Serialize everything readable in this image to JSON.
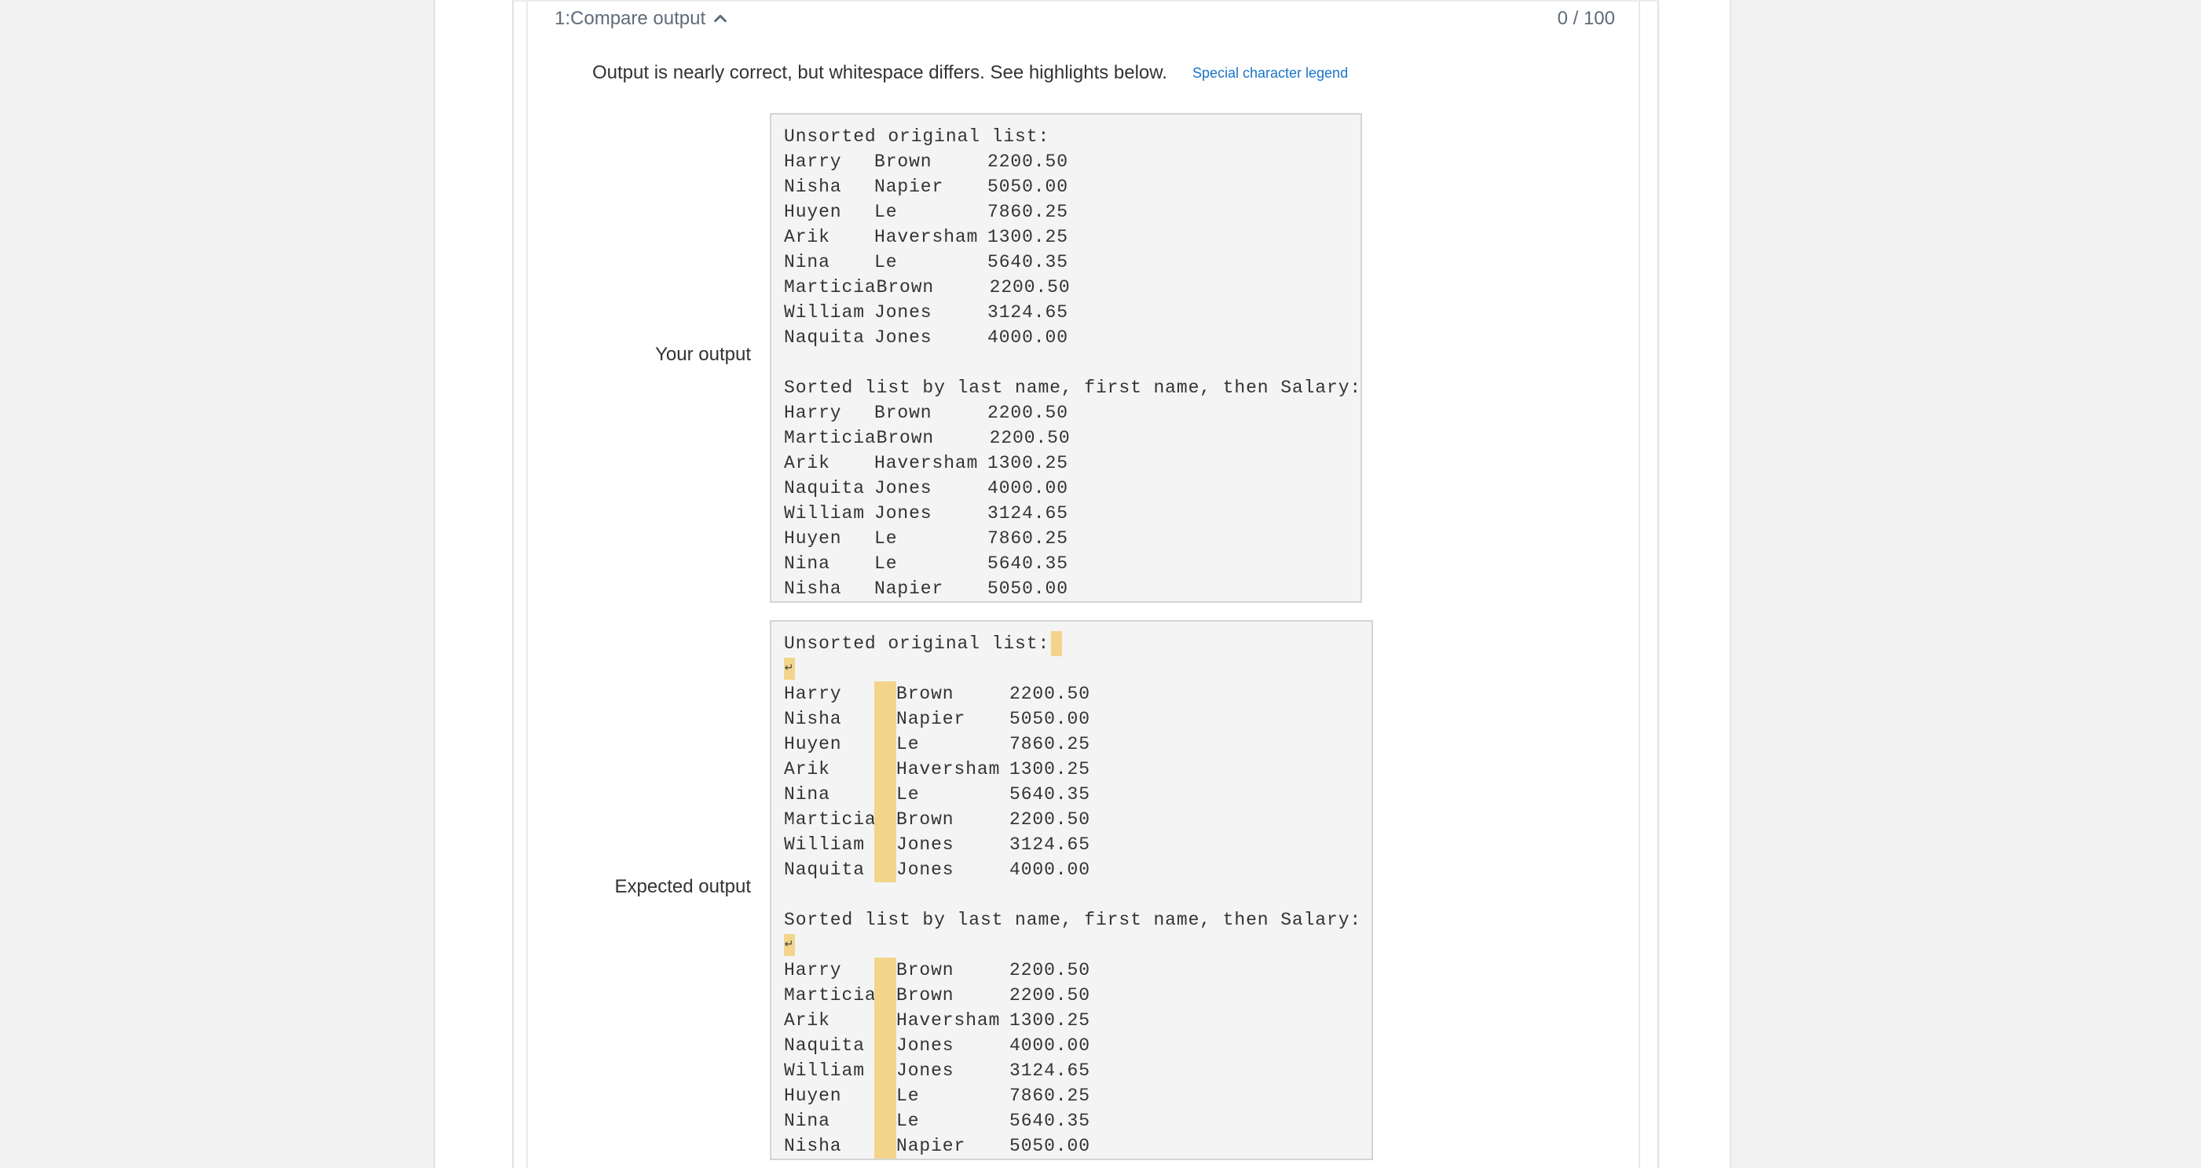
{
  "header": {
    "title": "1:Compare output",
    "score": "0 / 100",
    "toggle_icon": "chevron-up-icon"
  },
  "message": {
    "text": "Output is nearly correct, but whitespace differs. See highlights below.",
    "legend_link": "Special character legend"
  },
  "labels": {
    "yours": "Your output",
    "expected": "Expected output"
  },
  "colors": {
    "highlight": "#f2d58a",
    "link": "#1a73c8",
    "code_bg": "#f4f4f4"
  },
  "your_output": {
    "heading1": "Unsorted original list:",
    "unsorted": [
      [
        "Harry",
        "Brown",
        "2200.50"
      ],
      [
        "Nisha",
        "Napier",
        "5050.00"
      ],
      [
        "Huyen",
        "Le",
        "7860.25"
      ],
      [
        "Arik",
        "Haversham",
        "1300.25"
      ],
      [
        "Nina",
        "Le",
        "5640.35"
      ],
      [
        "Marticia",
        "Brown",
        "2200.50"
      ],
      [
        "William",
        "Jones",
        "3124.65"
      ],
      [
        "Naquita",
        "Jones",
        "4000.00"
      ]
    ],
    "heading2": "Sorted list by last name, first name, then Salary:",
    "sorted": [
      [
        "Harry",
        "Brown",
        "2200.50"
      ],
      [
        "Marticia",
        "Brown",
        "2200.50"
      ],
      [
        "Arik",
        "Haversham",
        "1300.25"
      ],
      [
        "Naquita",
        "Jones",
        "4000.00"
      ],
      [
        "William",
        "Jones",
        "3124.65"
      ],
      [
        "Huyen",
        "Le",
        "7860.25"
      ],
      [
        "Nina",
        "Le",
        "5640.35"
      ],
      [
        "Nisha",
        "Napier",
        "5050.00"
      ]
    ]
  },
  "expected_output": {
    "heading1": "Unsorted original list:",
    "newline_symbol": "↵",
    "unsorted": [
      [
        "Harry",
        "Brown",
        "2200.50"
      ],
      [
        "Nisha",
        "Napier",
        "5050.00"
      ],
      [
        "Huyen",
        "Le",
        "7860.25"
      ],
      [
        "Arik",
        "Haversham",
        "1300.25"
      ],
      [
        "Nina",
        "Le",
        "5640.35"
      ],
      [
        "Marticia",
        "Brown",
        "2200.50"
      ],
      [
        "William",
        "Jones",
        "3124.65"
      ],
      [
        "Naquita",
        "Jones",
        "4000.00"
      ]
    ],
    "heading2": "Sorted list by last name, first name, then Salary:",
    "sorted": [
      [
        "Harry",
        "Brown",
        "2200.50"
      ],
      [
        "Marticia",
        "Brown",
        "2200.50"
      ],
      [
        "Arik",
        "Haversham",
        "1300.25"
      ],
      [
        "Naquita",
        "Jones",
        "4000.00"
      ],
      [
        "William",
        "Jones",
        "3124.65"
      ],
      [
        "Huyen",
        "Le",
        "7860.25"
      ],
      [
        "Nina",
        "Le",
        "5640.35"
      ],
      [
        "Nisha",
        "Napier",
        "5050.00"
      ]
    ]
  }
}
